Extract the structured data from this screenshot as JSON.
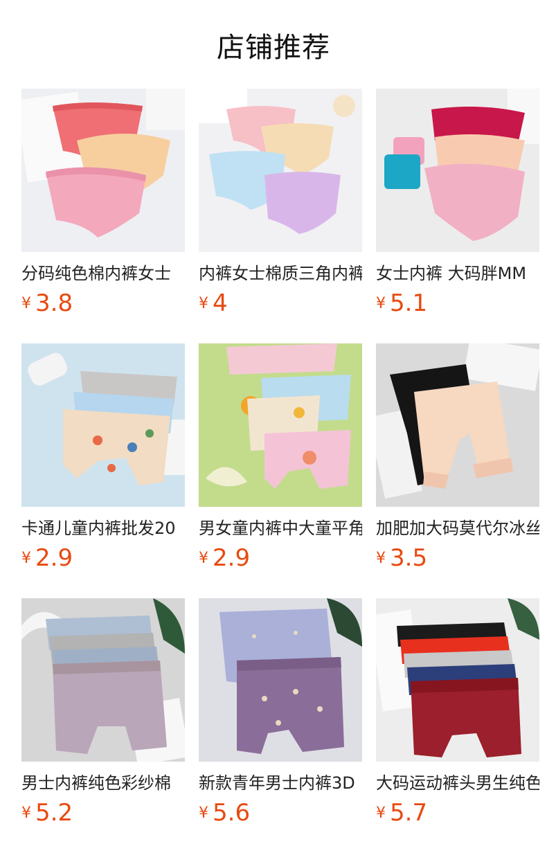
{
  "header": {
    "title": "店铺推荐"
  },
  "currency_symbol": "¥",
  "products": [
    {
      "name": "分码纯色棉内裤女士",
      "price": "3.8",
      "image": "womens-briefs-pink-peach-photo"
    },
    {
      "name": "内裤女士棉质三角内裤",
      "price": "4",
      "image": "womens-briefs-pastel-photo"
    },
    {
      "name": "女士内裤 大码胖MM",
      "price": "5.1",
      "image": "womens-lace-briefs-photo"
    },
    {
      "name": "卡通儿童内裤批发20",
      "price": "2.9",
      "image": "kids-cartoon-boxers-photo"
    },
    {
      "name": "男女童内裤中大童平角",
      "price": "2.9",
      "image": "kids-fruit-boxers-photo"
    },
    {
      "name": "加肥加大码莫代尔冰丝",
      "price": "3.5",
      "image": "safety-shorts-lace-photo"
    },
    {
      "name": "男士内裤纯色彩纱棉",
      "price": "5.2",
      "image": "mens-boxers-grey-photo"
    },
    {
      "name": "新款青年男士内裤3D",
      "price": "5.6",
      "image": "mens-boxers-purple-print-photo"
    },
    {
      "name": "大码运动裤头男生纯色",
      "price": "5.7",
      "image": "mens-boxers-multicolor-photo"
    }
  ]
}
